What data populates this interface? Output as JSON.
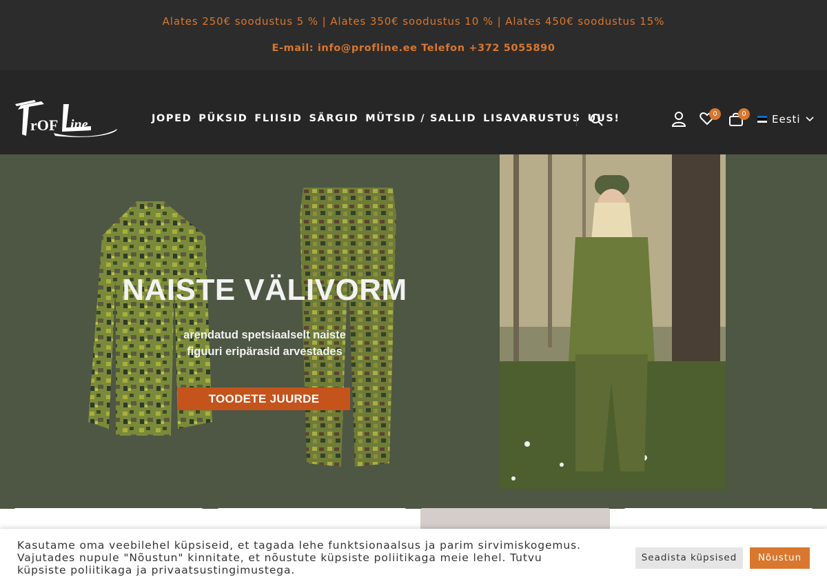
{
  "topbar": {
    "promo": "Alates 250€ soodustus 5 % |  Alates 350€ soodustus 10 % | Alates 450€ soodustus 15%",
    "contact": "E-mail: info@profline.ee Telefon +372 5055890",
    "color": "#d9772e"
  },
  "header": {
    "logo_text": "ProfLine",
    "nav": [
      "JOPED",
      "PÜKSID",
      "FLIISID",
      "SÄRGID",
      "MÜTSID / SALLID",
      "LISAVARUSTUS",
      "UUS!"
    ],
    "icons": [
      "search-icon",
      "user-icon",
      "heart-icon",
      "cart-icon"
    ],
    "wishlist_count": "0",
    "cart_count": "0",
    "language": "Eesti"
  },
  "hero": {
    "title": "NAISTE VÄLIVORM",
    "subtitle_line1": "arendatud spetsiaalselt naiste",
    "subtitle_line2": "figuuri eripärasid arvestades",
    "cta": "TOODETE JUURDE",
    "accent": "#c4531c"
  },
  "cookie": {
    "text": "Kasutame oma veebilehel küpsiseid, et tagada lehe funktsionaalsus ja parim sirvimiskogemus. Vajutades nupule \"Nõustun\" kinnitate, et nõustute küpsiste poliitikaga meie lehel. Tutvu küpsiste poliitikaga ja privaatsustingimustega.",
    "settings_label": "Seadista küpsised",
    "accept_label": "Nõustun"
  }
}
